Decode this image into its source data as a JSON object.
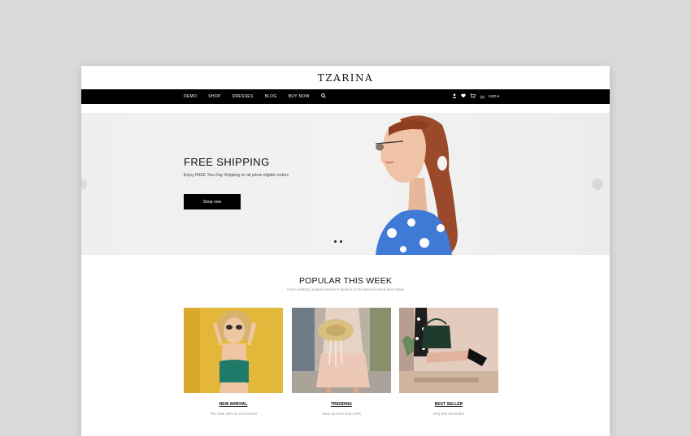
{
  "brand": {
    "logo": "TZARINA"
  },
  "nav": {
    "items": [
      "DEMO",
      "SHOP",
      "DRESSES",
      "BLOG",
      "BUY NOW"
    ],
    "cart_count": "(0)",
    "currency": "USD"
  },
  "hero": {
    "title": "FREE SHIPPING",
    "subtitle": "Enjoy FREE Two-Day Shipping on all prime eligible orders",
    "button": "Shop now"
  },
  "popular": {
    "title": "POPULAR THIS WEEK",
    "subtitle": "From celebrity inspired women's fashion to the latest in trend-lead styles",
    "cards": [
      {
        "label": "NEW ARRIVAL",
        "desc": "The Sale 20% on new arrival"
      },
      {
        "label": "TRENDING",
        "desc": "Save up more than 30%"
      },
      {
        "label": "BEST SELLER",
        "desc": "Only this december"
      }
    ]
  },
  "colors": {
    "nav_bg": "#000000",
    "page_bg": "#d9d9d9",
    "accent": "#111111"
  },
  "icons": [
    "search-icon",
    "user-icon",
    "heart-icon",
    "cart-icon",
    "chevron-left-icon",
    "chevron-right-icon"
  ]
}
